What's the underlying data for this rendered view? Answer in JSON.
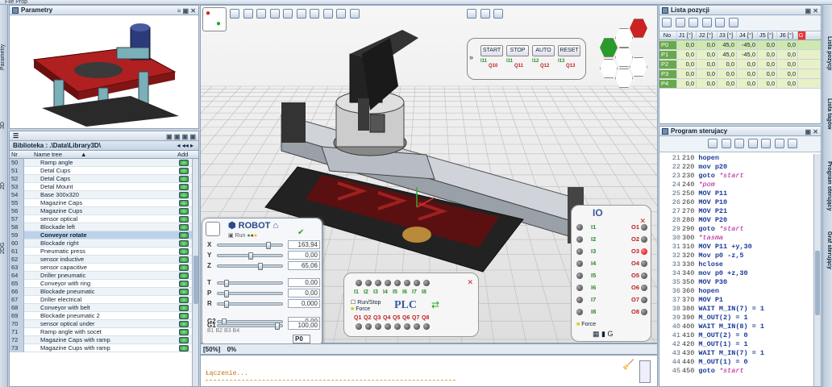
{
  "topbar": {
    "text": "File  Prop"
  },
  "left_tabs": [
    "Parametry",
    "3D",
    "2D",
    "2DG"
  ],
  "right_tabs": [
    "Lista pozycji",
    "Lista tagów",
    "Program sterujący",
    "Graf sterujący"
  ],
  "params_panel": {
    "title": "Parametry"
  },
  "library": {
    "path_label": "Biblioteka : .\\Data\\Library3D\\",
    "headers": {
      "nr": "Nr",
      "name": "Name tree",
      "add": "Add"
    },
    "rows": [
      {
        "nr": "50",
        "name": "Ramp angle"
      },
      {
        "nr": "51",
        "name": "Detal Cups"
      },
      {
        "nr": "52",
        "name": "Detal Caps"
      },
      {
        "nr": "53",
        "name": "Detal Mount"
      },
      {
        "nr": "54",
        "name": "Base 300x320"
      },
      {
        "nr": "55",
        "name": "Magazine Caps"
      },
      {
        "nr": "56",
        "name": "Magazine Cups"
      },
      {
        "nr": "57",
        "name": "sensor optical"
      },
      {
        "nr": "58",
        "name": "Blockade  left"
      },
      {
        "nr": "59",
        "name": "Conveyor rotate"
      },
      {
        "nr": "60",
        "name": "Blockade  right"
      },
      {
        "nr": "61",
        "name": "Pneumatic press"
      },
      {
        "nr": "62",
        "name": "sensor inductive"
      },
      {
        "nr": "63",
        "name": "sensor capacitive"
      },
      {
        "nr": "64",
        "name": "Driller pneumatic"
      },
      {
        "nr": "65",
        "name": "Conveyor with ring"
      },
      {
        "nr": "66",
        "name": "Blockade pneumatic"
      },
      {
        "nr": "67",
        "name": "Driller electrical"
      },
      {
        "nr": "68",
        "name": "Conveyor with belt"
      },
      {
        "nr": "69",
        "name": "Blockade pneumatic 2"
      },
      {
        "nr": "70",
        "name": "sensor optical under"
      },
      {
        "nr": "71",
        "name": "Ramp angle with socet"
      },
      {
        "nr": "72",
        "name": "Magazine Caps with ramp"
      },
      {
        "nr": "73",
        "name": "Magazine Cups with ramp"
      }
    ],
    "selected_nr": "59"
  },
  "viewport": {
    "zoom_label": "[50%]",
    "zoom_value": "0%",
    "console_text": "Łączenie...",
    "control_buttons": [
      {
        "label": "START",
        "code": "Q10",
        "input": "I11"
      },
      {
        "label": "STOP",
        "code": "Q11",
        "input": "I11"
      },
      {
        "label": "AUTO",
        "code": "Q12",
        "input": "I12"
      },
      {
        "label": "RESET",
        "code": "Q13",
        "input": "I13"
      }
    ]
  },
  "robot": {
    "title": "ROBOT",
    "run_label": "Run",
    "axes": [
      {
        "name": "X",
        "value": "163,94",
        "pos": 0.79
      },
      {
        "name": "Y",
        "value": "0,00",
        "pos": 0.5
      },
      {
        "name": "Z",
        "value": "65,06",
        "pos": 0.66
      },
      {
        "name": "T",
        "value": "0,00",
        "pos": 0.1
      },
      {
        "name": "P",
        "value": "0,00",
        "pos": 0.1
      },
      {
        "name": "R",
        "value": "0,000",
        "pos": 0.1
      },
      {
        "name": "G2",
        "value": "0,00",
        "pos": 0.06
      },
      {
        "name": "G1",
        "value": "100,00",
        "pos": 0.94
      }
    ],
    "bits": [
      "B1",
      "B2",
      "B3",
      "B4"
    ],
    "pos_label": "P0"
  },
  "plc": {
    "title": "PLC",
    "inputs": [
      "I1",
      "I2",
      "I3",
      "I4",
      "I5",
      "I6",
      "I7",
      "I8"
    ],
    "outputs": [
      "Q1",
      "Q2",
      "Q3",
      "Q4",
      "Q5",
      "Q6",
      "Q7",
      "Q8"
    ],
    "runstop": "Run/Stop",
    "force": "Force"
  },
  "io": {
    "title": "IO",
    "rows": [
      {
        "i": "I1",
        "o": "O1"
      },
      {
        "i": "I2",
        "o": "O2"
      },
      {
        "i": "I3",
        "o": "O3"
      },
      {
        "i": "I4",
        "o": "O4"
      },
      {
        "i": "I5",
        "o": "O5"
      },
      {
        "i": "I6",
        "o": "O6"
      },
      {
        "i": "I7",
        "o": "O7"
      },
      {
        "i": "I8",
        "o": "O8"
      }
    ],
    "force": "Force"
  },
  "positions": {
    "title": "Lista pozycji",
    "headers": [
      "No",
      "J1 [°]",
      "J2 [°]",
      "J3 [°]",
      "J4 [°]",
      "J5 [°]",
      "J6 [°]",
      "G"
    ],
    "rows": [
      [
        "P0",
        "0,0",
        "0,0",
        "45,0",
        "-45,0",
        "0,0",
        "0,0"
      ],
      [
        "P1",
        "0,0",
        "0,0",
        "45,0",
        "-45,0",
        "0,0",
        "0,0"
      ],
      [
        "P2",
        "0,0",
        "0,0",
        "0,0",
        "0,0",
        "0,0",
        "0,0"
      ],
      [
        "P3",
        "0,0",
        "0,0",
        "0,0",
        "0,0",
        "0,0",
        "0,0"
      ],
      [
        "P4",
        "0,0",
        "0,0",
        "0,0",
        "0,0",
        "0,0",
        "0,0"
      ]
    ]
  },
  "program": {
    "title": "Program sterujacy",
    "lines": [
      [
        "21",
        "210",
        "hopen",
        ""
      ],
      [
        "22",
        "220",
        "mov p20",
        ""
      ],
      [
        "23",
        "230",
        "goto",
        "*start"
      ],
      [
        "24",
        "240",
        "",
        "*pom"
      ],
      [
        "25",
        "250",
        "MOV P11",
        ""
      ],
      [
        "26",
        "260",
        "MOV P10",
        ""
      ],
      [
        "27",
        "270",
        "MOV P21",
        ""
      ],
      [
        "28",
        "280",
        "MOV P20",
        ""
      ],
      [
        "29",
        "290",
        "goto",
        "*start"
      ],
      [
        "30",
        "300",
        "",
        "*tasma"
      ],
      [
        "31",
        "310",
        "MOV P11 +y,30",
        ""
      ],
      [
        "32",
        "320",
        "Mov p0 -z,5",
        ""
      ],
      [
        "33",
        "330",
        "hclose",
        ""
      ],
      [
        "34",
        "340",
        "mov p0 +z,30",
        ""
      ],
      [
        "35",
        "350",
        "MOV P30",
        ""
      ],
      [
        "36",
        "360",
        "hopen",
        ""
      ],
      [
        "37",
        "370",
        "MOV P1",
        ""
      ],
      [
        "38",
        "380",
        "WAIT M_IN(7) = 1",
        ""
      ],
      [
        "39",
        "390",
        "M_OUT(2) = 1",
        ""
      ],
      [
        "40",
        "400",
        "WAIT M_IN(8) = 1",
        ""
      ],
      [
        "41",
        "410",
        "M_OUT(2) = 0",
        ""
      ],
      [
        "42",
        "420",
        "M_OUT(1) = 1",
        ""
      ],
      [
        "43",
        "430",
        "WAIT M_IN(7) = 1",
        ""
      ],
      [
        "44",
        "440",
        "M_OUT(1) = 0",
        ""
      ],
      [
        "45",
        "450",
        "goto",
        "*start"
      ]
    ]
  }
}
